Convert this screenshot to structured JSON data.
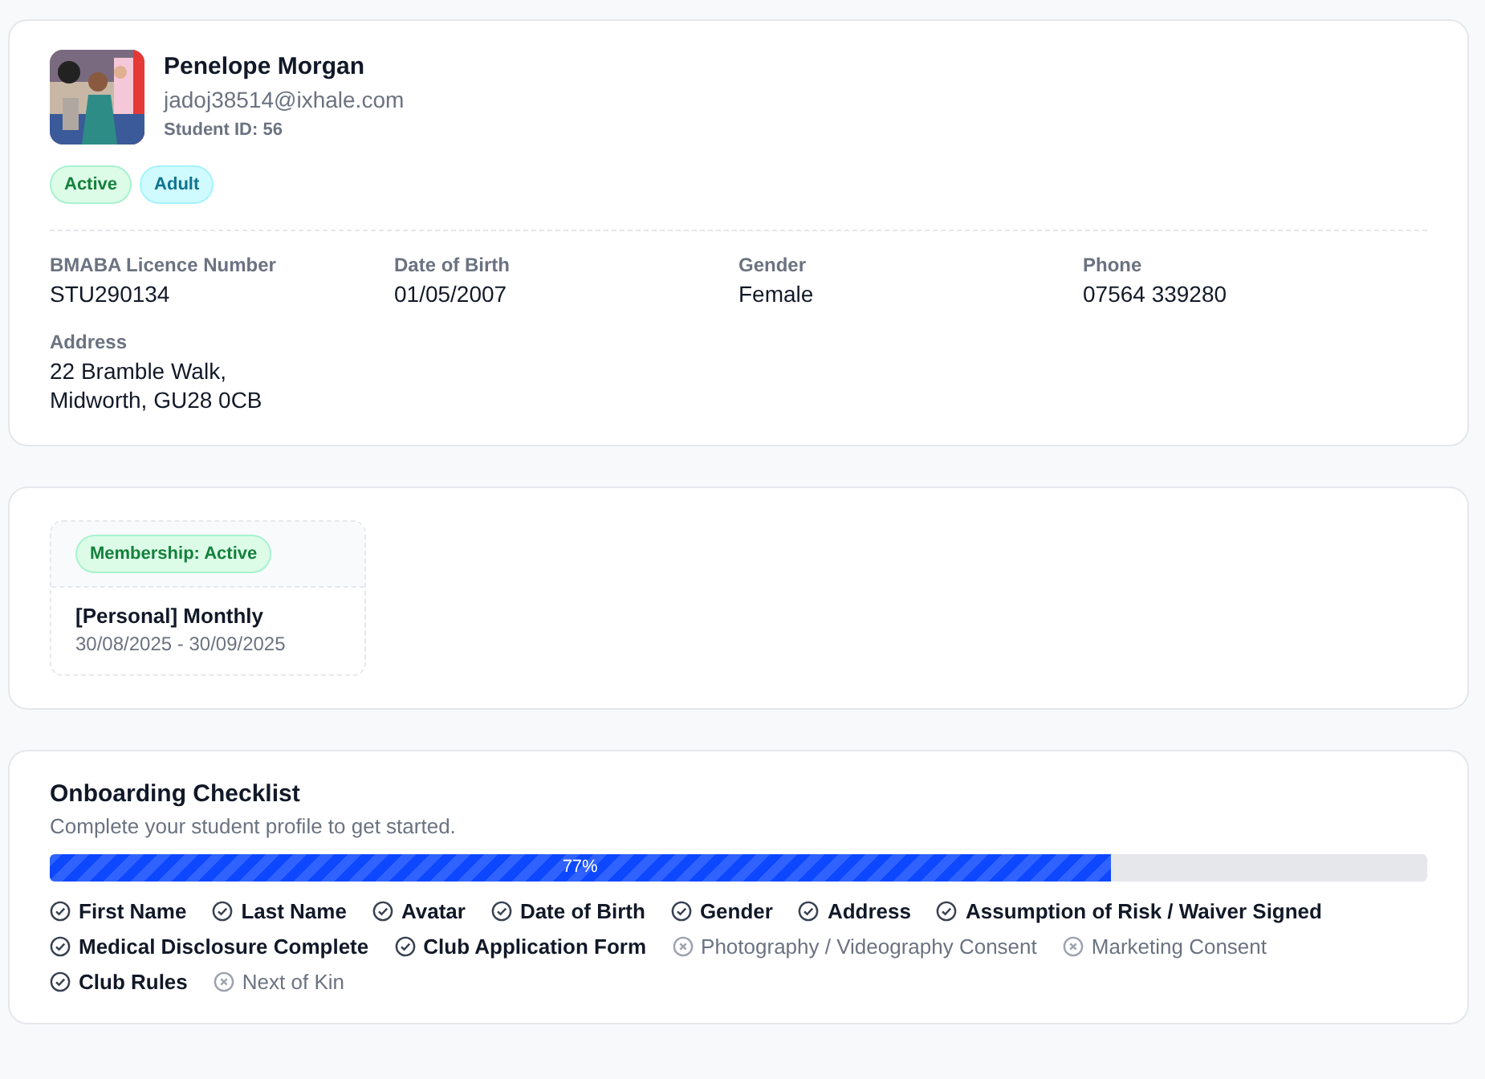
{
  "profile": {
    "name": "Penelope Morgan",
    "email": "jadoj38514@ixhale.com",
    "student_id": "Student ID: 56",
    "tags": [
      {
        "label": "Active",
        "kind": "success"
      },
      {
        "label": "Adult",
        "kind": "info"
      }
    ],
    "fields": [
      {
        "label": "BMABA Licence Number",
        "value": "STU290134"
      },
      {
        "label": "Date of Birth",
        "value": "01/05/2007"
      },
      {
        "label": "Gender",
        "value": "Female"
      },
      {
        "label": "Phone",
        "value": "07564 339280"
      },
      {
        "label": "Address",
        "value": "22 Bramble Walk,\nMidworth, GU28 0CB"
      }
    ]
  },
  "memberships": [
    {
      "status": "Membership: Active",
      "kind": "success",
      "plan": "[Personal] Monthly",
      "dates": "30/08/2025 - 30/09/2025"
    }
  ],
  "checklist": {
    "title": "Onboarding Checklist",
    "subtitle": "Complete your student profile to get started.",
    "progress": {
      "level": 0.77,
      "label": "77%"
    },
    "items": [
      {
        "label": "First Name",
        "done": true
      },
      {
        "label": "Last Name",
        "done": true
      },
      {
        "label": "Avatar",
        "done": true
      },
      {
        "label": "Date of Birth",
        "done": true
      },
      {
        "label": "Gender",
        "done": true
      },
      {
        "label": "Address",
        "done": true
      },
      {
        "label": "Assumption of Risk / Waiver Signed",
        "done": true
      },
      {
        "label": "Medical Disclosure Complete",
        "done": true
      },
      {
        "label": "Club Application Form",
        "done": true
      },
      {
        "label": "Photography / Videography Consent",
        "done": false
      },
      {
        "label": "Marketing Consent",
        "done": false
      },
      {
        "label": "Club Rules",
        "done": true
      },
      {
        "label": "Next of Kin",
        "done": false
      }
    ]
  }
}
